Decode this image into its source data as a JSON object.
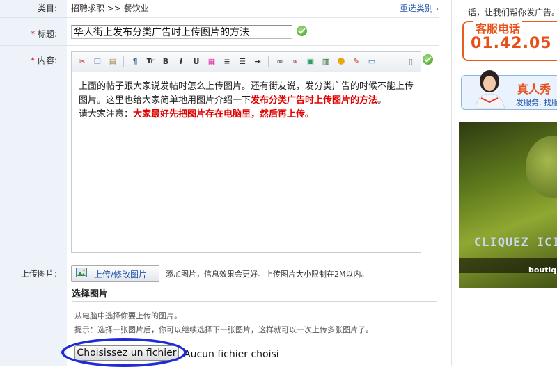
{
  "form": {
    "category": {
      "label": "类目:",
      "value": "招聘求职 >> 餐饮业",
      "reselect": "重选类别"
    },
    "title": {
      "required": "*",
      "label": "标题:",
      "value": "华人街上发布分类广告时上传图片的方法"
    },
    "content": {
      "required": "*",
      "label": "内容:",
      "line1": "上面的帖子跟大家说发帖时怎么上传图片。还有街友说，发分类广告的时候不能上传图片。这里也给大家简单地用图片介绍一下",
      "bold1": "发布分类广告时上传图片的方法",
      "line1_end": "。",
      "line2": "请大家注意：",
      "bold2": "大家最好先把图片存在电脑里，然后再上传。"
    },
    "upload": {
      "label": "上传图片:",
      "button": "上传/修改图片",
      "hint": "添加图片，信息效果会更好。上传图片大小限制在2M以内。",
      "section_title": "选择图片",
      "desc1": "从电脑中选择你要上传的图片。",
      "desc2": "提示：选择一张图片后，你可以继续选择下一张图片，这样就可以一次上传多张图片了。",
      "file_button": "Choisissez un fichier",
      "file_status": "Aucun fichier choisi"
    }
  },
  "toolbar_icons": [
    "cut-icon",
    "copy-icon",
    "paste-icon",
    "format-icon",
    "font-size-icon",
    "bold-icon",
    "italic-icon",
    "underline-icon",
    "color-icon",
    "align-icon",
    "list-icon",
    "indent-icon",
    "link-icon",
    "unlink-icon",
    "image-icon",
    "video-icon",
    "emoticon-icon",
    "edit-icon",
    "save-icon",
    "source-icon"
  ],
  "toolbar_labels": {
    "font_size": "Tr",
    "bold": "B",
    "italic": "I",
    "underline": "U"
  },
  "sidebar": {
    "intro": "话，让我们帮你发广告。",
    "hotline_title": "客服电话",
    "hotline_number": "01.42.05",
    "service_title": "真人秀",
    "service_sub": "发服务, 找服",
    "banner_text": "CLIQUEZ ICI",
    "banner_sub": "boutique"
  },
  "colors": {
    "accent_red": "#e00000",
    "link_blue": "#2255aa",
    "orange": "#e8501a",
    "oval_blue": "#1f2bd6"
  }
}
